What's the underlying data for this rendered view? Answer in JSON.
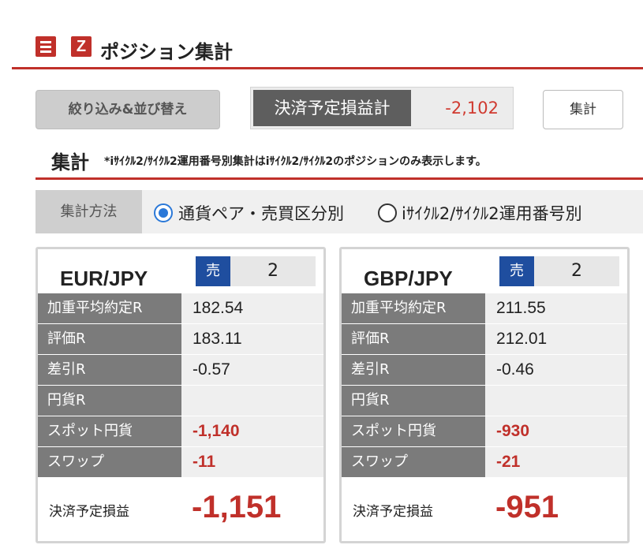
{
  "header": {
    "title": "ポジション集計",
    "menu_icon": "hamburger-icon",
    "logo_icon": "z-logo-icon"
  },
  "toolbar": {
    "filter_label": "絞り込み&並び替え",
    "pl_label": "決済予定損益計",
    "pl_value": "-2,102",
    "sum_label": "集計"
  },
  "section": {
    "title": "集計",
    "note": "*iｻｲｸﾙ2/ｻｲｸﾙ2運用番号別集計はiｻｲｸﾙ2/ｻｲｸﾙ2のポジションのみ表示します。"
  },
  "method": {
    "label": "集計方法",
    "option1": "通貨ペア・売買区分別",
    "option2": "iｻｲｸﾙ2/ｻｲｸﾙ2運用番号別",
    "selected": "option1"
  },
  "colors": {
    "accent": "#c0302a",
    "sell_badge": "#1f4e9f",
    "radio": "#2a78d8"
  },
  "cards": [
    {
      "pair": "EUR/JPY",
      "side": "売",
      "qty": "2",
      "rows": [
        {
          "label": "加重平均約定R",
          "value": "182.54"
        },
        {
          "label": "評価R",
          "value": "183.11"
        },
        {
          "label": "差引R",
          "value": "-0.57"
        },
        {
          "label": "円貨R",
          "value": ""
        },
        {
          "label": "スポット円貨",
          "value": "-1,140"
        },
        {
          "label": "スワップ",
          "value": "-11"
        }
      ],
      "total_label": "決済予定損益",
      "total_value": "-1,151"
    },
    {
      "pair": "GBP/JPY",
      "side": "売",
      "qty": "2",
      "rows": [
        {
          "label": "加重平均約定R",
          "value": "211.55"
        },
        {
          "label": "評価R",
          "value": "212.01"
        },
        {
          "label": "差引R",
          "value": "-0.46"
        },
        {
          "label": "円貨R",
          "value": ""
        },
        {
          "label": "スポット円貨",
          "value": "-930"
        },
        {
          "label": "スワップ",
          "value": "-21"
        }
      ],
      "total_label": "決済予定損益",
      "total_value": "-951"
    }
  ]
}
